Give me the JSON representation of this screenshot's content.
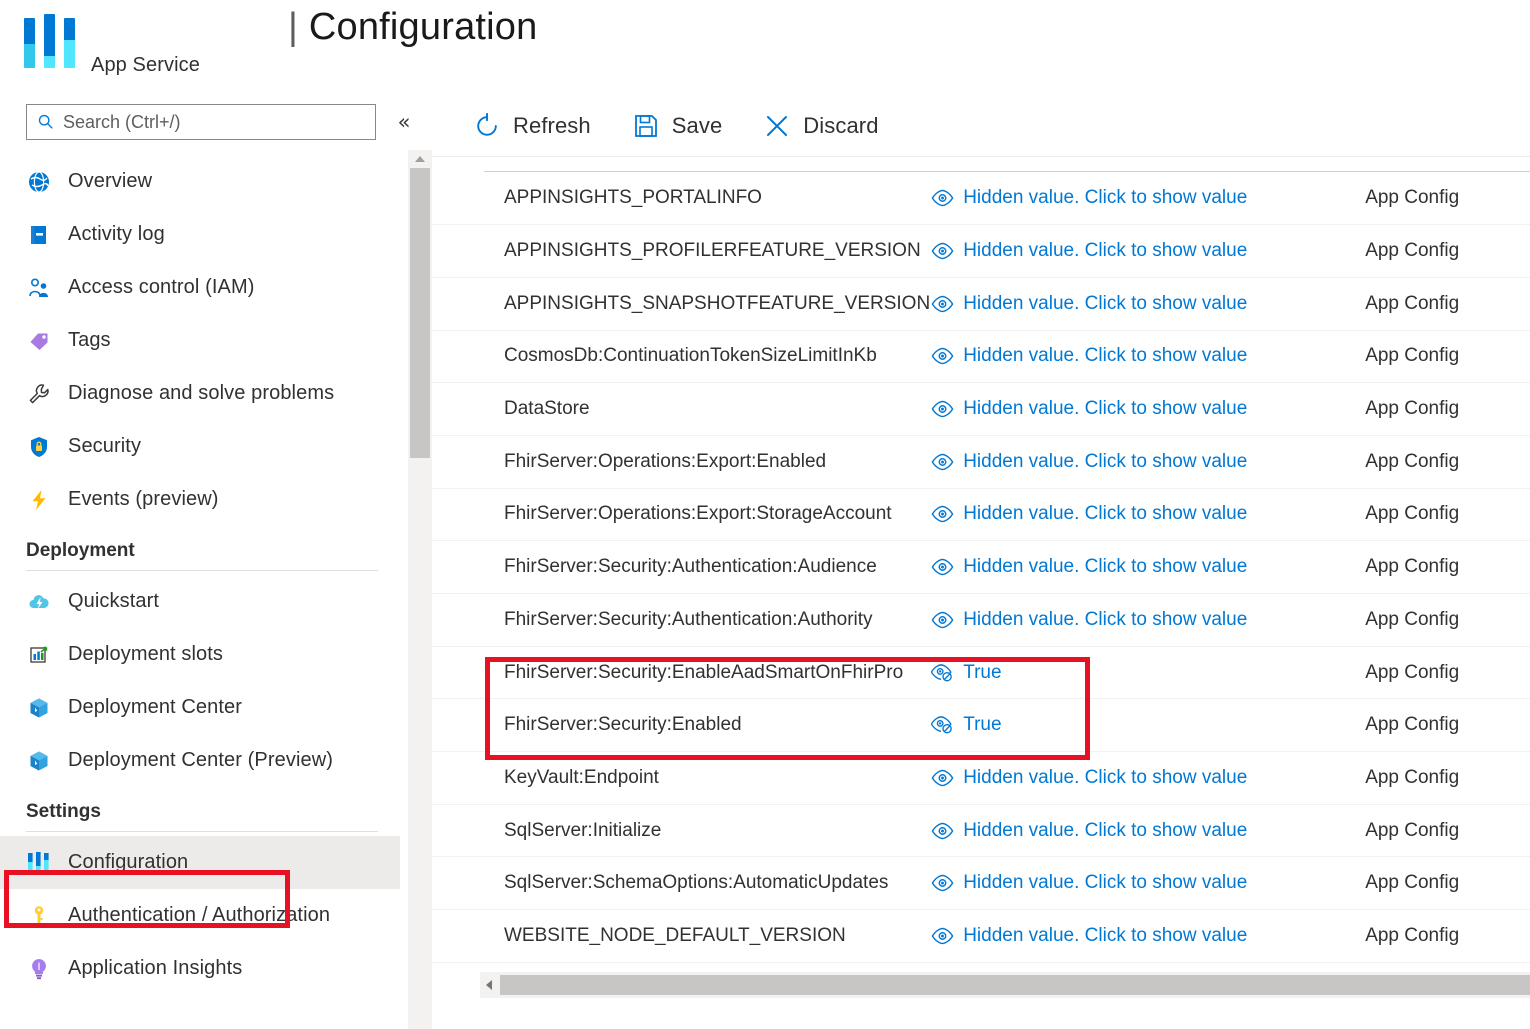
{
  "header": {
    "title_prefix": "|",
    "title": "Configuration",
    "resource_type": "App Service",
    "logo_icon": "app-service-sliders-icon"
  },
  "sidebar": {
    "search": {
      "placeholder": "Search (Ctrl+/)",
      "icon": "search-icon",
      "value": ""
    },
    "collapse_icon": "chevron-double-left-icon",
    "items": [
      {
        "label": "Overview",
        "icon": "globe-icon",
        "selected": false
      },
      {
        "label": "Activity log",
        "icon": "activity-log-icon",
        "selected": false
      },
      {
        "label": "Access control (IAM)",
        "icon": "people-icon",
        "selected": false
      },
      {
        "label": "Tags",
        "icon": "tag-icon",
        "selected": false
      },
      {
        "label": "Diagnose and solve problems",
        "icon": "wrench-icon",
        "selected": false
      },
      {
        "label": "Security",
        "icon": "shield-lock-icon",
        "selected": false
      },
      {
        "label": "Events (preview)",
        "icon": "lightning-bolt-icon",
        "selected": false
      }
    ],
    "groups": [
      {
        "title": "Deployment",
        "items": [
          {
            "label": "Quickstart",
            "icon": "cloud-bolt-icon",
            "selected": false
          },
          {
            "label": "Deployment slots",
            "icon": "bar-chart-icon",
            "selected": false
          },
          {
            "label": "Deployment Center",
            "icon": "cube-icon",
            "selected": false
          },
          {
            "label": "Deployment Center (Preview)",
            "icon": "cube-icon",
            "selected": false
          }
        ]
      },
      {
        "title": "Settings",
        "items": [
          {
            "label": "Configuration",
            "icon": "sliders-icon",
            "selected": true
          },
          {
            "label": "Authentication / Authorization",
            "icon": "key-icon",
            "selected": false
          },
          {
            "label": "Application Insights",
            "icon": "lightbulb-icon",
            "selected": false
          }
        ]
      }
    ]
  },
  "toolbar": {
    "refresh_label": "Refresh",
    "refresh_icon": "refresh-icon",
    "save_label": "Save",
    "save_icon": "save-disk-icon",
    "discard_label": "Discard",
    "discard_icon": "close-x-icon"
  },
  "table": {
    "hidden_value_label": "Hidden value. Click to show value",
    "hidden_icon": "eye-icon",
    "shown_icon": "eye-hidden-icon",
    "rows": [
      {
        "name": "APPINSIGHTS_PORTALINFO",
        "value": "Hidden value. Click to show value",
        "hidden": true,
        "source": "App Config",
        "highlighted": false
      },
      {
        "name": "APPINSIGHTS_PROFILERFEATURE_VERSION",
        "value": "Hidden value. Click to show value",
        "hidden": true,
        "source": "App Config",
        "highlighted": false
      },
      {
        "name": "APPINSIGHTS_SNAPSHOTFEATURE_VERSION",
        "value": "Hidden value. Click to show value",
        "hidden": true,
        "source": "App Config",
        "highlighted": false
      },
      {
        "name": "CosmosDb:ContinuationTokenSizeLimitInKb",
        "value": "Hidden value. Click to show value",
        "hidden": true,
        "source": "App Config",
        "highlighted": false
      },
      {
        "name": "DataStore",
        "value": "Hidden value. Click to show value",
        "hidden": true,
        "source": "App Config",
        "highlighted": false
      },
      {
        "name": "FhirServer:Operations:Export:Enabled",
        "value": "Hidden value. Click to show value",
        "hidden": true,
        "source": "App Config",
        "highlighted": false
      },
      {
        "name": "FhirServer:Operations:Export:StorageAccount",
        "value": "Hidden value. Click to show value",
        "hidden": true,
        "source": "App Config",
        "highlighted": false
      },
      {
        "name": "FhirServer:Security:Authentication:Audience",
        "value": "Hidden value. Click to show value",
        "hidden": true,
        "source": "App Config",
        "highlighted": false
      },
      {
        "name": "FhirServer:Security:Authentication:Authority",
        "value": "Hidden value. Click to show value",
        "hidden": true,
        "source": "App Config",
        "highlighted": false
      },
      {
        "name": "FhirServer:Security:EnableAadSmartOnFhirPro",
        "value": "True",
        "hidden": false,
        "source": "App Config",
        "highlighted": true
      },
      {
        "name": "FhirServer:Security:Enabled",
        "value": "True",
        "hidden": false,
        "source": "App Config",
        "highlighted": true
      },
      {
        "name": "KeyVault:Endpoint",
        "value": "Hidden value. Click to show value",
        "hidden": true,
        "source": "App Config",
        "highlighted": false
      },
      {
        "name": "SqlServer:Initialize",
        "value": "Hidden value. Click to show value",
        "hidden": true,
        "source": "App Config",
        "highlighted": false
      },
      {
        "name": "SqlServer:SchemaOptions:AutomaticUpdates",
        "value": "Hidden value. Click to show value",
        "hidden": true,
        "source": "App Config",
        "highlighted": false
      },
      {
        "name": "WEBSITE_NODE_DEFAULT_VERSION",
        "value": "Hidden value. Click to show value",
        "hidden": true,
        "source": "App Config",
        "highlighted": false
      }
    ]
  },
  "annotations": {
    "highlight_color": "#e81123",
    "boxes": [
      "configuration-sidebar-item",
      "fhirserver-security-rows"
    ]
  },
  "colors": {
    "accent": "#0078d4",
    "link": "#0078d4",
    "selected_row_bg": "#edebe9",
    "logo_dark": "#0078d4",
    "logo_light": "#50e6ff"
  }
}
